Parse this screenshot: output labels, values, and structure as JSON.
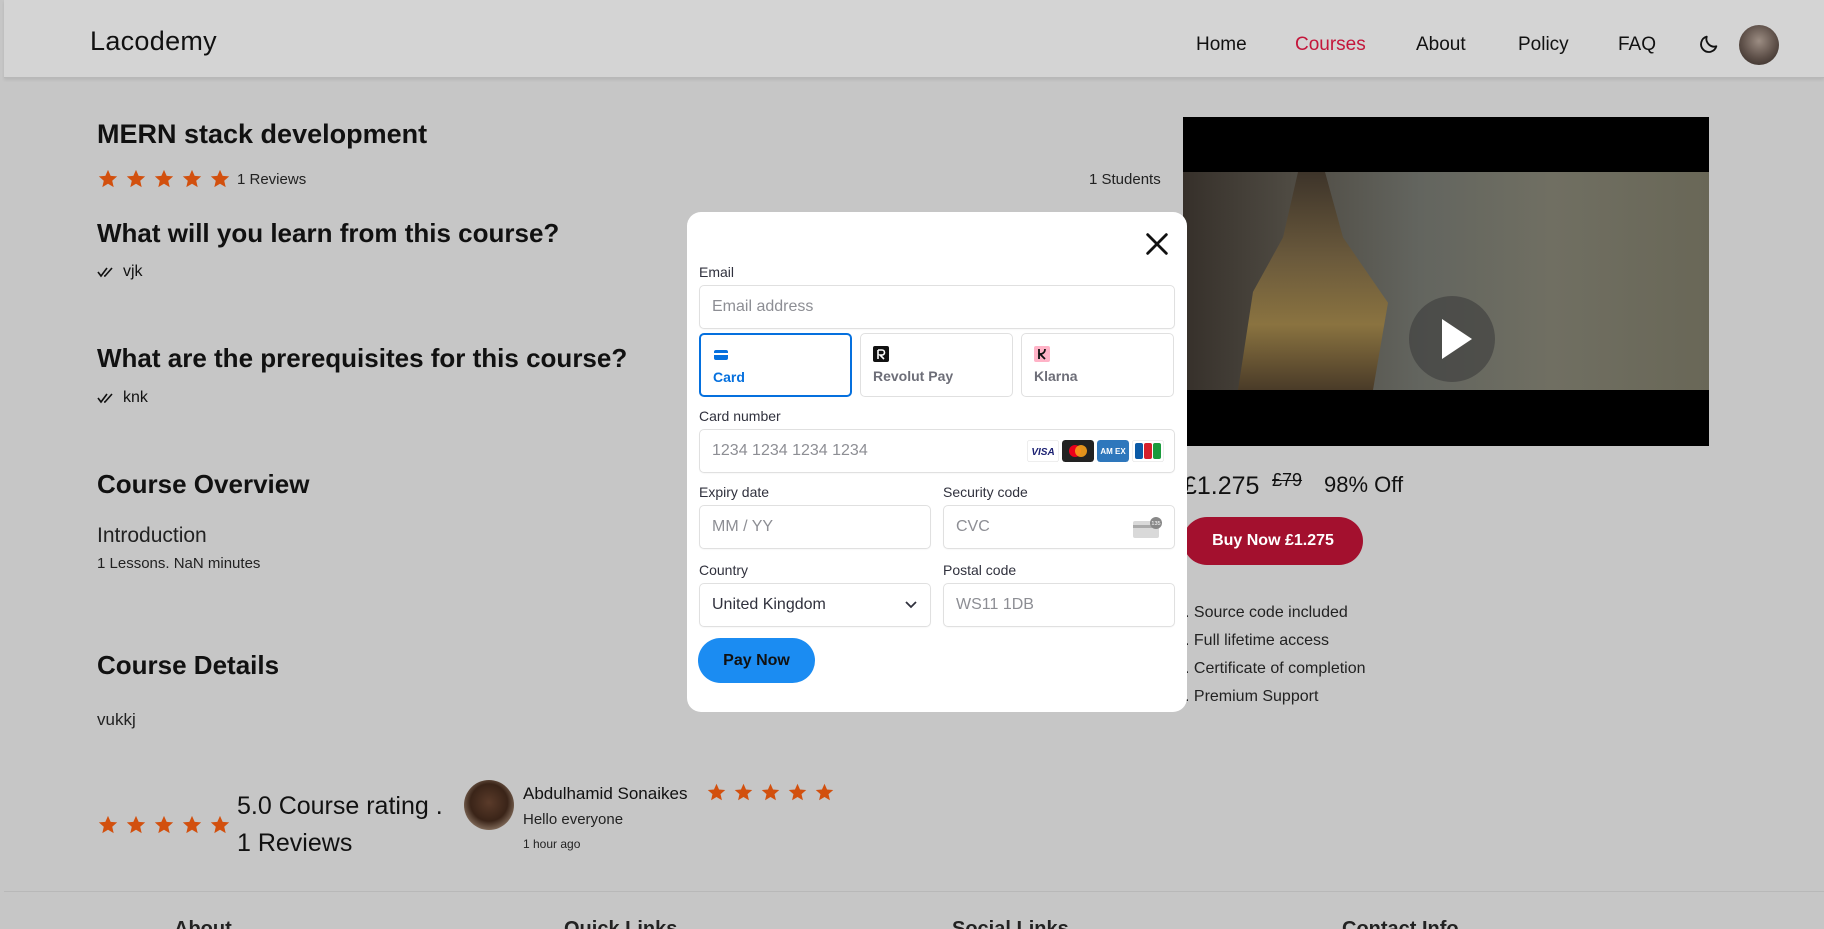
{
  "header": {
    "brand": "Lacodemy",
    "nav": [
      "Home",
      "Courses",
      "About",
      "Policy",
      "FAQ"
    ],
    "active_nav": "Courses"
  },
  "course": {
    "title": "MERN stack development",
    "rating_stars": 5,
    "reviews_label": "1 Reviews",
    "students_label": "1 Students",
    "learn_heading": "What will you learn from this course?",
    "learn_items": [
      "vjk"
    ],
    "prereq_heading": "What are the prerequisites for this course?",
    "prereq_items": [
      "knk"
    ],
    "overview_heading": "Course Overview",
    "overview_section": "Introduction",
    "overview_meta": "1 Lessons. NaN minutes",
    "details_heading": "Course Details",
    "details_text": "vukkj",
    "rating_summary": "5.0 Course rating .",
    "rating_reviews": "1 Reviews"
  },
  "review": {
    "author": "Abdulhamid Sonaikes",
    "stars": 5,
    "text": "Hello everyone",
    "time": "1 hour ago"
  },
  "purchase": {
    "price": "£1.275",
    "old_price": "£79",
    "discount": "98% Off",
    "buy_label": "Buy Now £1.275",
    "features": [
      ". Source code included",
      ". Full lifetime access",
      ". Certificate of completion",
      ". Premium Support"
    ]
  },
  "footer": {
    "headings": [
      "About",
      "Quick Links",
      "Social Links",
      "Contact Info"
    ]
  },
  "payment_modal": {
    "email_label": "Email",
    "email_placeholder": "Email address",
    "tabs": [
      {
        "label": "Card",
        "icon": "card-icon"
      },
      {
        "label": "Revolut Pay",
        "icon": "revolut-icon"
      },
      {
        "label": "Klarna",
        "icon": "klarna-icon"
      }
    ],
    "selected_tab": "Card",
    "card_number_label": "Card number",
    "card_number_placeholder": "1234 1234 1234 1234",
    "card_brands": [
      "visa-icon",
      "mastercard-icon",
      "amex-icon",
      "jcb-icon"
    ],
    "expiry_label": "Expiry date",
    "expiry_placeholder": "MM / YY",
    "cvc_label": "Security code",
    "cvc_placeholder": "CVC",
    "cvc_icon_text": "135",
    "country_label": "Country",
    "country_value": "United Kingdom",
    "postal_label": "Postal code",
    "postal_placeholder": "WS11 1DB",
    "pay_label": "Pay Now"
  },
  "colors": {
    "overlay_bg": "#c6c6c6",
    "accent_red": "#c4163b",
    "buy_button": "#a3102e",
    "star": "#d2500e",
    "stripe_blue": "#0570de",
    "pay_button": "#1b8cf2"
  }
}
